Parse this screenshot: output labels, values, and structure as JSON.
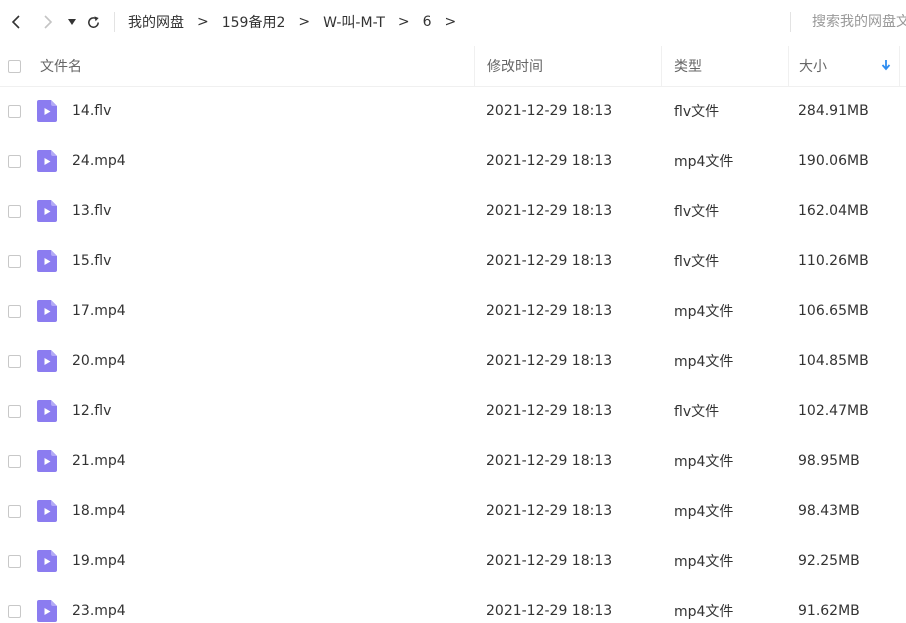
{
  "nav": {
    "breadcrumb": [
      "我的网盘",
      "159备用2",
      "W-叫-M-T",
      "6"
    ],
    "crumb_separator": ">",
    "search_placeholder": "搜索我的网盘文件"
  },
  "table": {
    "columns": {
      "name": "文件名",
      "date": "修改时间",
      "type": "类型",
      "size": "大小"
    },
    "sort": {
      "column": "size",
      "direction": "desc"
    },
    "rows": [
      {
        "name": "14.flv",
        "date": "2021-12-29 18:13",
        "type": "flv文件",
        "size": "284.91MB"
      },
      {
        "name": "24.mp4",
        "date": "2021-12-29 18:13",
        "type": "mp4文件",
        "size": "190.06MB"
      },
      {
        "name": "13.flv",
        "date": "2021-12-29 18:13",
        "type": "flv文件",
        "size": "162.04MB"
      },
      {
        "name": "15.flv",
        "date": "2021-12-29 18:13",
        "type": "flv文件",
        "size": "110.26MB"
      },
      {
        "name": "17.mp4",
        "date": "2021-12-29 18:13",
        "type": "mp4文件",
        "size": "106.65MB"
      },
      {
        "name": "20.mp4",
        "date": "2021-12-29 18:13",
        "type": "mp4文件",
        "size": "104.85MB"
      },
      {
        "name": "12.flv",
        "date": "2021-12-29 18:13",
        "type": "flv文件",
        "size": "102.47MB"
      },
      {
        "name": "21.mp4",
        "date": "2021-12-29 18:13",
        "type": "mp4文件",
        "size": "98.95MB"
      },
      {
        "name": "18.mp4",
        "date": "2021-12-29 18:13",
        "type": "mp4文件",
        "size": "98.43MB"
      },
      {
        "name": "19.mp4",
        "date": "2021-12-29 18:13",
        "type": "mp4文件",
        "size": "92.25MB"
      },
      {
        "name": "23.mp4",
        "date": "2021-12-29 18:13",
        "type": "mp4文件",
        "size": "91.62MB"
      }
    ]
  },
  "icons": {
    "file": "video-file-icon",
    "sort": "sort-arrow-down-icon"
  },
  "colors": {
    "video_icon": "#8b7cf0",
    "sort_arrow": "#2d8cf0",
    "text": "#333333",
    "muted": "#666666",
    "disabled": "#c4c4c4"
  }
}
